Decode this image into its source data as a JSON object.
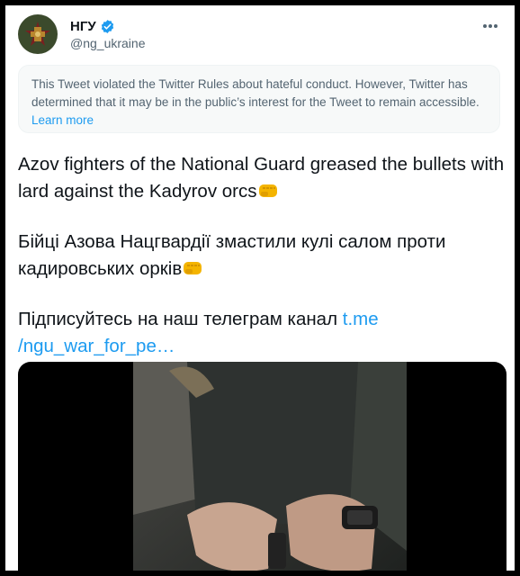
{
  "tweet": {
    "author": {
      "display_name": "НГУ",
      "handle": "@ng_ukraine",
      "avatar_icon": "national-guard-emblem-icon",
      "verified_icon": "verified-badge-icon"
    },
    "notice": {
      "text": "This Tweet violated the Twitter Rules about hateful conduct. However, Twitter has determined that it may be in the public’s interest for the Tweet to remain accessible.",
      "link_label": "Learn more"
    },
    "body": {
      "line_en": "Azov fighters of the National Guard greased the bullets with lard against the Kadyrov orcs",
      "line_uk": "Бійці Азова Нацгвардії змастили кулі салом проти кадировських орків",
      "line_cta": "Підписуйтесь на наш телеграм канал",
      "link_label": "t.me /ngu_war_for_pe…",
      "emoji_icon": "oncoming-fist-emoji-icon"
    },
    "media": {
      "type": "video-thumbnail"
    }
  },
  "colors": {
    "link": "#1d9bf0",
    "text": "#0f1419",
    "secondary": "#536471",
    "notice_bg": "#f7f9f9"
  }
}
